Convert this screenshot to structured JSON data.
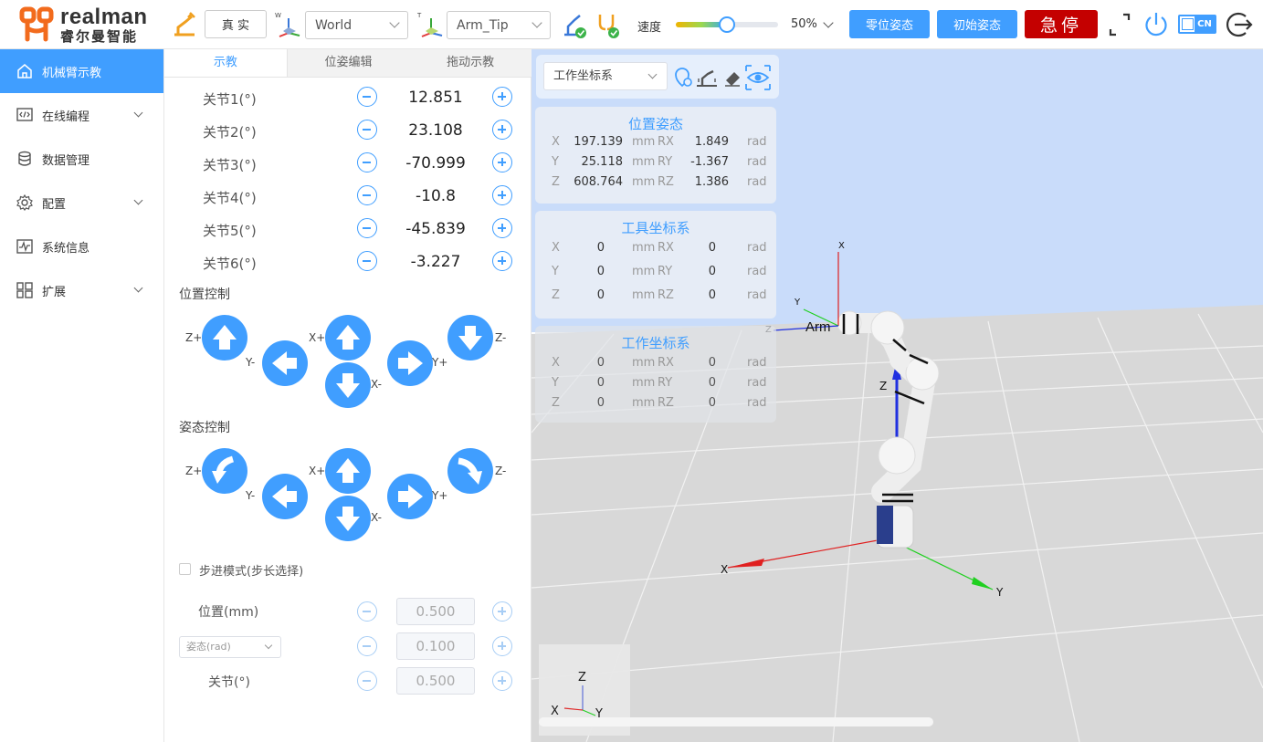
{
  "header": {
    "logo_en": "realman",
    "logo_cn": "睿尔曼智能",
    "mode_button": "真 实",
    "frame_select": "World",
    "frame_superscript": "W",
    "tool_select": "Arm_Tip",
    "tool_superscript": "T",
    "speed_label": "速度",
    "speed_percent": "50%",
    "speed_value": 0.5,
    "zero_pose_button": "零位姿态",
    "init_pose_button": "初始姿态",
    "estop_button": "急停",
    "lang_badge": "CN",
    "colors": {
      "accent": "#409eff",
      "estop": "#c40000",
      "logo_orange": "#f26b1d"
    }
  },
  "sidebar": {
    "items": [
      {
        "label": "机械臂示教",
        "icon": "home-icon",
        "active": true
      },
      {
        "label": "在线编程",
        "icon": "code-icon",
        "expand": true
      },
      {
        "label": "数据管理",
        "icon": "database-icon"
      },
      {
        "label": "配置",
        "icon": "settings-gear-icon",
        "expand": true
      },
      {
        "label": "系统信息",
        "icon": "pulse-monitor-icon"
      },
      {
        "label": "扩展",
        "icon": "grid-apps-icon",
        "expand": true
      }
    ]
  },
  "panel": {
    "tabs": [
      "示教",
      "位姿编辑",
      "拖动示教"
    ],
    "joints": [
      {
        "label": "关节1(°)",
        "value": "12.851"
      },
      {
        "label": "关节2(°)",
        "value": "23.108"
      },
      {
        "label": "关节3(°)",
        "value": "-70.999"
      },
      {
        "label": "关节4(°)",
        "value": "-10.8"
      },
      {
        "label": "关节5(°)",
        "value": "-45.839"
      },
      {
        "label": "关节6(°)",
        "value": "-3.227"
      }
    ],
    "position_control_title": "位置控制",
    "attitude_control_title": "姿态控制",
    "arrow_labels": {
      "zp": "Z+",
      "zm": "Z-",
      "yp": "Y+",
      "ym": "Y-",
      "xp": "X+",
      "xm": "X-"
    },
    "step_mode_label": "步进模式(步长选择)",
    "step_position_label": "位置(mm)",
    "step_position_value": "0.500",
    "step_attitude_select": "姿态(rad)",
    "step_attitude_value": "0.100",
    "step_joint_label": "关节(°)",
    "step_joint_value": "0.500"
  },
  "viewport": {
    "coord_select": "工作坐标系",
    "pose_card": {
      "title": "位置姿态",
      "rows": [
        {
          "axis": "X",
          "value": "197.139",
          "unit": "mm",
          "raxis": "RX",
          "rvalue": "1.849",
          "runit": "rad"
        },
        {
          "axis": "Y",
          "value": "25.118",
          "unit": "mm",
          "raxis": "RY",
          "rvalue": "-1.367",
          "runit": "rad"
        },
        {
          "axis": "Z",
          "value": "608.764",
          "unit": "mm",
          "raxis": "RZ",
          "rvalue": "1.386",
          "runit": "rad"
        }
      ]
    },
    "tool_card": {
      "title": "工具坐标系",
      "rows": [
        {
          "axis": "X",
          "value": "0",
          "unit": "mm",
          "raxis": "RX",
          "rvalue": "0",
          "runit": "rad"
        },
        {
          "axis": "Y",
          "value": "0",
          "unit": "mm",
          "raxis": "RY",
          "rvalue": "0",
          "runit": "rad"
        },
        {
          "axis": "Z",
          "value": "0",
          "unit": "mm",
          "raxis": "RZ",
          "rvalue": "0",
          "runit": "rad"
        }
      ]
    },
    "work_card": {
      "title": "工作坐标系",
      "rows": [
        {
          "axis": "X",
          "value": "0",
          "unit": "mm",
          "raxis": "RX",
          "rvalue": "0",
          "runit": "rad"
        },
        {
          "axis": "Y",
          "value": "0",
          "unit": "mm",
          "raxis": "RY",
          "rvalue": "0",
          "runit": "rad"
        },
        {
          "axis": "Z",
          "value": "0",
          "unit": "mm",
          "raxis": "RZ",
          "rvalue": "0",
          "runit": "rad"
        }
      ]
    },
    "scene_labels": {
      "x": "X",
      "y": "Y",
      "z": "Z",
      "tool": "Arm"
    },
    "gizmo_labels": {
      "x": "X",
      "y": "Y",
      "z": "Z"
    }
  }
}
